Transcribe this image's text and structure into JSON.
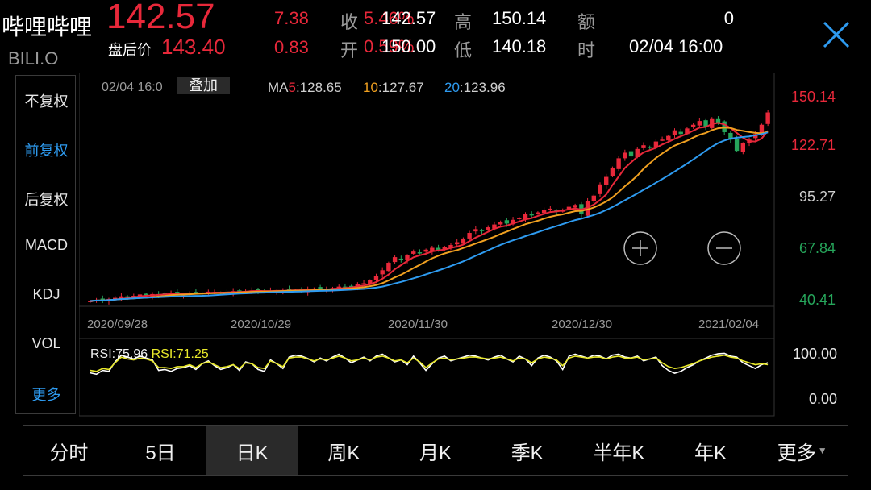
{
  "header": {
    "name": "哔哩哔哩",
    "code": "BILI.O",
    "last_price": "142.57",
    "after_hours_label": "盘后价",
    "after_hours_price": "143.40",
    "change": "7.38",
    "after_hours_change": "0.83",
    "quote": {
      "close_label": "收",
      "close_pct": "5.46%",
      "close_value": "142.57",
      "open_label": "开",
      "open_pct": "0.59%",
      "open_value": "150.00",
      "high_label": "高",
      "high_value": "150.14",
      "low_label": "低",
      "low_value": "140.18",
      "amount_label": "额",
      "amount_value": "0",
      "time_label": "时",
      "time_value": "02/04 16:00"
    }
  },
  "left_menu": {
    "items": [
      {
        "label": "不复权",
        "active": false
      },
      {
        "label": "前复权",
        "active": true
      },
      {
        "label": "后复权",
        "active": false
      },
      {
        "label": "MACD",
        "active": false
      },
      {
        "label": "KDJ",
        "active": false
      },
      {
        "label": "VOL",
        "active": false
      },
      {
        "label": "更多",
        "active": true
      }
    ]
  },
  "chart_info": {
    "date": "02/04 16:0",
    "overlay_button": "叠加",
    "ma5_label": "MA5:",
    "ma5_prefix": "MA",
    "ma5_num": "5",
    "ma5_value": "128.65",
    "ma10_label": "10",
    "ma10_value": "127.67",
    "ma20_label": "20",
    "ma20_value": "123.96",
    "rsi_label1": "RSI:",
    "rsi_value1": "75.96",
    "rsi_label2": "RSI:",
    "rsi_value2": "71.25"
  },
  "colors": {
    "up": "#e8283a",
    "down": "#26a65b",
    "ma5": "#e8283a",
    "ma10": "#f0a020",
    "ma20": "#2e9bf0",
    "rsi1": "#ffffff",
    "rsi2": "#e8e82a",
    "accent": "#2e9bf0"
  },
  "chart_data": {
    "type": "candlestick",
    "price_axis_ticks": [
      "150.14",
      "122.71",
      "95.27",
      "67.84",
      "40.41"
    ],
    "price_range": [
      40.41,
      150.14
    ],
    "date_ticks": [
      "2020/09/28",
      "2020/10/29",
      "2020/11/30",
      "2020/12/30",
      "2021/02/04"
    ],
    "rsi_ticks": [
      "100.00",
      "0.00"
    ],
    "rsi_range": [
      0,
      100
    ],
    "ma_legend": {
      "MA5": 128.65,
      "MA10": 127.67,
      "MA20": 123.96
    },
    "rsi_legend": {
      "RSI1": 75.96,
      "RSI2": 71.25
    },
    "closes": [
      41.5,
      42.0,
      41.8,
      42.6,
      43.2,
      44.0,
      43.5,
      44.3,
      45.0,
      44.6,
      45.2,
      44.8,
      45.5,
      46.0,
      45.4,
      45.0,
      45.6,
      46.2,
      45.8,
      46.5,
      46.0,
      45.7,
      46.3,
      46.8,
      47.0,
      46.6,
      47.2,
      47.0,
      46.4,
      47.1,
      46.9,
      47.3,
      47.8,
      47.4,
      47.0,
      47.6,
      48.2,
      48.0,
      47.6,
      48.5,
      49.2,
      48.8,
      49.5,
      50.5,
      51.0,
      52.5,
      55.0,
      58.0,
      62.0,
      65.0,
      63.5,
      66.0,
      68.0,
      67.5,
      69.0,
      70.0,
      68.5,
      70.5,
      71.5,
      73.0,
      75.0,
      78.0,
      80.0,
      79.0,
      81.0,
      82.5,
      84.0,
      83.0,
      85.0,
      86.0,
      88.0,
      87.5,
      89.0,
      90.5,
      91.0,
      89.5,
      90.0,
      92.0,
      93.0,
      88.0,
      95.0,
      98.0,
      104.0,
      108.0,
      113.0,
      118.0,
      121.0,
      119.0,
      123.0,
      125.0,
      124.0,
      127.0,
      128.0,
      130.0,
      133.0,
      131.0,
      134.0,
      136.0,
      138.0,
      135.0,
      139.0,
      137.0,
      132.0,
      128.0,
      122.0,
      126.0,
      128.0,
      131.0,
      136.0,
      142.57
    ],
    "rsi1": [
      55,
      52,
      60,
      58,
      78,
      92,
      88,
      84,
      90,
      86,
      82,
      60,
      62,
      58,
      64,
      66,
      70,
      62,
      74,
      80,
      70,
      62,
      66,
      72,
      60,
      78,
      74,
      62,
      58,
      82,
      74,
      64,
      88,
      92,
      90,
      85,
      78,
      86,
      80,
      88,
      94,
      86,
      76,
      82,
      88,
      80,
      90,
      94,
      86,
      78,
      82,
      72,
      90,
      76,
      60,
      74,
      86,
      90,
      80,
      84,
      88,
      92,
      90,
      86,
      82,
      88,
      92,
      84,
      78,
      90,
      84,
      70,
      86,
      92,
      88,
      80,
      62,
      90,
      94,
      90,
      86,
      92,
      90,
      84,
      92,
      94,
      88,
      86,
      90,
      80,
      84,
      88,
      70,
      60,
      54,
      58,
      66,
      72,
      80,
      86,
      92,
      95,
      96,
      90,
      88,
      76,
      70,
      64,
      72,
      76
    ],
    "rsi2": [
      60,
      58,
      64,
      62,
      76,
      88,
      84,
      82,
      86,
      84,
      80,
      66,
      66,
      64,
      68,
      68,
      72,
      66,
      74,
      78,
      72,
      66,
      68,
      72,
      64,
      76,
      74,
      66,
      64,
      80,
      74,
      68,
      86,
      88,
      88,
      84,
      80,
      84,
      82,
      86,
      90,
      86,
      80,
      82,
      86,
      82,
      88,
      90,
      86,
      80,
      82,
      76,
      86,
      78,
      66,
      76,
      84,
      86,
      82,
      84,
      86,
      88,
      88,
      86,
      84,
      86,
      88,
      84,
      80,
      86,
      84,
      76,
      84,
      88,
      86,
      82,
      70,
      86,
      90,
      88,
      86,
      88,
      88,
      84,
      88,
      90,
      86,
      86,
      88,
      82,
      84,
      86,
      76,
      68,
      64,
      66,
      70,
      74,
      80,
      84,
      88,
      90,
      92,
      88,
      86,
      80,
      76,
      72,
      74,
      72
    ]
  },
  "tabs": [
    {
      "label": "分时",
      "active": false
    },
    {
      "label": "5日",
      "active": false
    },
    {
      "label": "日K",
      "active": true
    },
    {
      "label": "周K",
      "active": false
    },
    {
      "label": "月K",
      "active": false
    },
    {
      "label": "季K",
      "active": false
    },
    {
      "label": "半年K",
      "active": false
    },
    {
      "label": "年K",
      "active": false
    },
    {
      "label": "更多",
      "active": false,
      "has_caret": true
    }
  ]
}
